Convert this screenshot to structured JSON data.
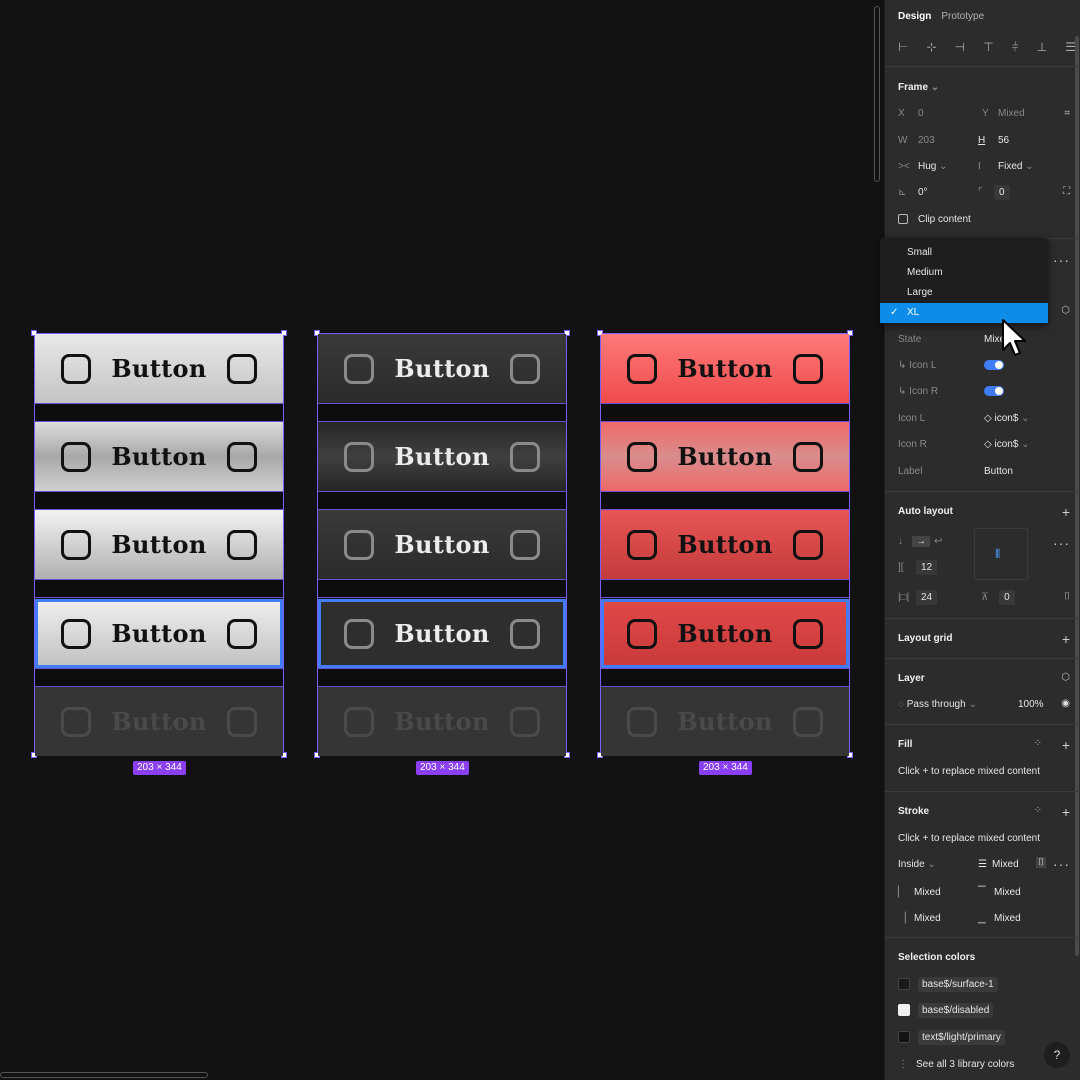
{
  "canvas": {
    "button_label": "Button",
    "frame_size_badge": "203 × 344",
    "columns": [
      "light",
      "dark",
      "red"
    ]
  },
  "panel": {
    "tabs": [
      "Design",
      "Prototype"
    ],
    "frame": {
      "title": "Frame",
      "x_label": "X",
      "x_value": "0",
      "y_label": "Y",
      "y_value": "Mixed",
      "w_label": "W",
      "w_value": "203",
      "h_label": "H",
      "h_value": "56",
      "hug": "Hug",
      "fixed": "Fixed",
      "rotation": "0°",
      "radius": "0",
      "clip_content": "Clip content"
    },
    "dropdown": {
      "options": [
        "Small",
        "Medium",
        "Large",
        "XL"
      ],
      "selected": "XL"
    },
    "props": {
      "state_label": "State",
      "state_value": "Mixed",
      "icon_l_toggle": "Icon L",
      "icon_r_toggle": "Icon R",
      "icon_l_label": "Icon L",
      "icon_l_value": "icon$",
      "icon_r_label": "Icon R",
      "icon_r_value": "icon$",
      "label_label": "Label",
      "label_value": "Button"
    },
    "auto_layout": {
      "title": "Auto layout",
      "gap": "12",
      "padding_h": "24",
      "padding_v": "0"
    },
    "layout_grid": {
      "title": "Layout grid"
    },
    "layer": {
      "title": "Layer",
      "blend": "Pass through",
      "opacity": "100%"
    },
    "fill": {
      "title": "Fill",
      "hint": "Click + to replace mixed content"
    },
    "stroke": {
      "title": "Stroke",
      "hint": "Click + to replace mixed content",
      "position": "Inside",
      "weight": "Mixed",
      "sides": [
        "Mixed",
        "Mixed",
        "Mixed",
        "Mixed"
      ]
    },
    "selection_colors": {
      "title": "Selection colors",
      "items": [
        {
          "name": "base$/surface-1",
          "color": "#1a1a1a"
        },
        {
          "name": "base$/disabled",
          "color": "#f0f0f0"
        },
        {
          "name": "text$/light/primary",
          "color": "#141414"
        }
      ],
      "see_all": "See all 3 library colors"
    },
    "help": "?"
  },
  "colors": {
    "accent_blue": "#0d8ce9",
    "frame_purple": "#7b5cff",
    "badge_purple": "#8a3ff5",
    "focus_blue": "#3f7cf5"
  }
}
